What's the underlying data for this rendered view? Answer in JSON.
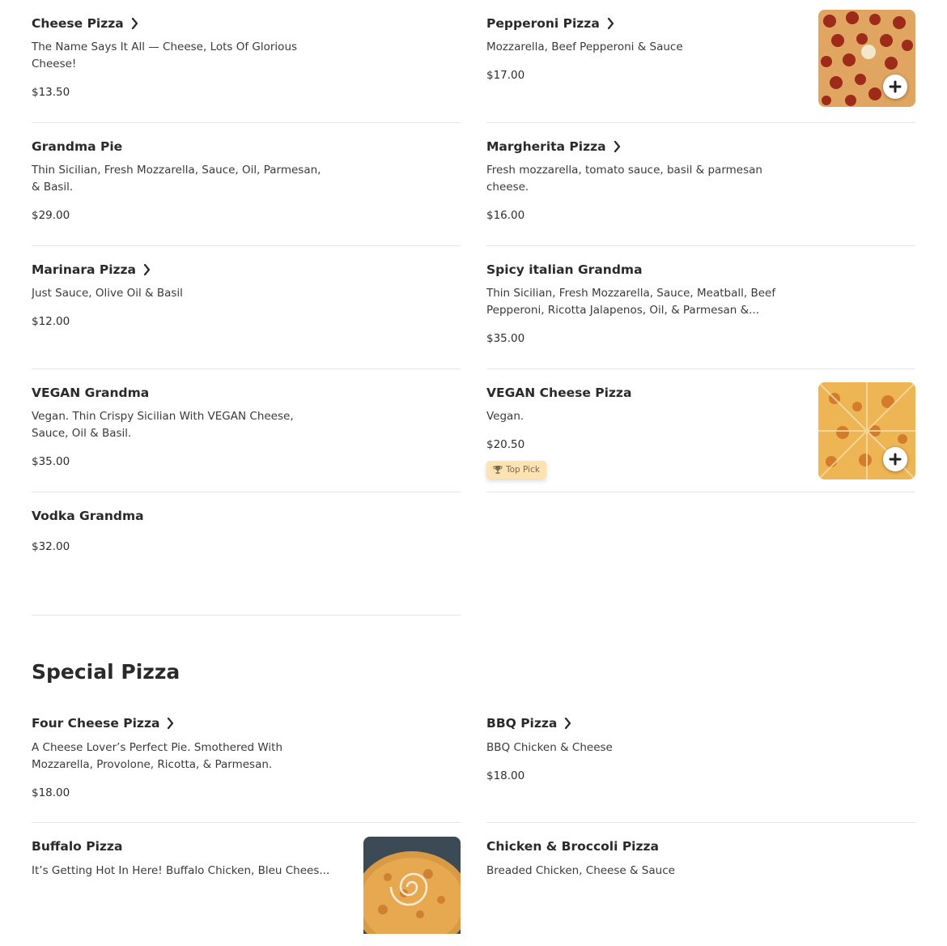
{
  "menu_top": [
    {
      "title": "Cheese Pizza",
      "chevron": true,
      "desc": "The Name Says It All — Cheese, Lots Of Glorious Cheese!",
      "price": "$13.50"
    },
    {
      "title": "Pepperoni Pizza",
      "chevron": true,
      "desc": "Mozzarella, Beef Pepperoni & Sauce",
      "price": "$17.00",
      "image": "pepperoni-pizza-photo"
    },
    {
      "title": "Grandma Pie",
      "chevron": false,
      "desc": "Thin Sicilian, Fresh Mozzarella, Sauce, Oil, Parmesan, & Basil.",
      "price": "$29.00"
    },
    {
      "title": "Margherita Pizza",
      "chevron": true,
      "desc": "Fresh mozzarella, tomato sauce, basil & parmesan cheese.",
      "price": "$16.00"
    },
    {
      "title": "Marinara Pizza",
      "chevron": true,
      "desc": "Just Sauce, Olive Oil & Basil",
      "price": "$12.00"
    },
    {
      "title": "Spicy italian Grandma",
      "chevron": false,
      "desc": "Thin Sicilian, Fresh Mozzarella, Sauce, Meatball, Beef Pepperoni, Ricotta Jalapenos, Oil, & Parmesan &...",
      "price": "$35.00"
    },
    {
      "title": "VEGAN Grandma",
      "chevron": false,
      "desc": "Vegan. Thin Crispy Sicilian With VEGAN Cheese, Sauce, Oil & Basil.",
      "price": "$35.00"
    },
    {
      "title": "VEGAN Cheese Pizza",
      "chevron": false,
      "desc": "Vegan.",
      "price": "$20.50",
      "image": "cheese-pizza-photo",
      "badge": "Top Pick"
    },
    {
      "title": "Vodka Grandma",
      "chevron": false,
      "desc": "",
      "price": "$32.00"
    }
  ],
  "special_section": {
    "title": "Special Pizza",
    "items": [
      {
        "title": "Four Cheese Pizza",
        "chevron": true,
        "desc": "A Cheese Lover’s Perfect Pie. Smothered With Mozzarella, Provolone, Ricotta, & Parmesan.",
        "price": "$18.00"
      },
      {
        "title": "BBQ Pizza",
        "chevron": true,
        "desc": "BBQ Chicken & Cheese",
        "price": "$18.00"
      },
      {
        "title": "Buffalo Pizza",
        "chevron": false,
        "desc": "It’s Getting Hot In Here! Buffalo Chicken, Bleu Chees...",
        "price": "",
        "image": "buffalo-pizza-photo"
      },
      {
        "title": "Chicken & Broccoli Pizza",
        "chevron": false,
        "desc": "Breaded Chicken, Cheese & Sauce",
        "price": ""
      }
    ]
  },
  "icons": {
    "chevron": "chevron-right-icon",
    "add": "plus-icon",
    "badge": "trophy-icon"
  },
  "colors": {
    "text": "#2d2d2d",
    "divider": "#e6e6e6",
    "badge_bg": "#fde3b2"
  }
}
